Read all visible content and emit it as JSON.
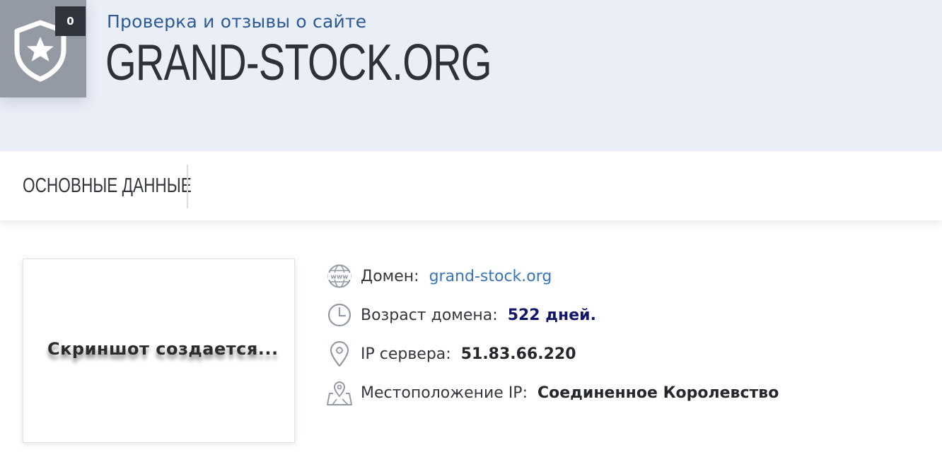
{
  "header": {
    "subtitle": "Проверка и отзывы о сайте",
    "title": "GRAND-STOCK.ORG",
    "reviews_count": "0",
    "shield_icon": "shield-star-icon"
  },
  "tabs": [
    {
      "label": "ОСНОВНЫЕ ДАННЫЕ"
    }
  ],
  "screenshot": {
    "placeholder_text": "Скриншот создается..."
  },
  "info": {
    "domain": {
      "icon": "www-globe-icon",
      "label": "Домен:",
      "value": "grand-stock.org"
    },
    "age": {
      "icon": "clock-icon",
      "label": "Возраст домена:",
      "value": "522 дней."
    },
    "ip": {
      "icon": "map-pin-icon",
      "label": "IP сервера:",
      "value": "51.83.66.220"
    },
    "location": {
      "icon": "map-location-icon",
      "label": "Местоположение IP:",
      "value": "Соединенное Королевство"
    }
  },
  "colors": {
    "header_bg": "#eaeef7",
    "accent_blue": "#2b5b96",
    "link_blue": "#3a74b8",
    "age_navy": "#13176b",
    "icon_gray": "#939aa4"
  }
}
